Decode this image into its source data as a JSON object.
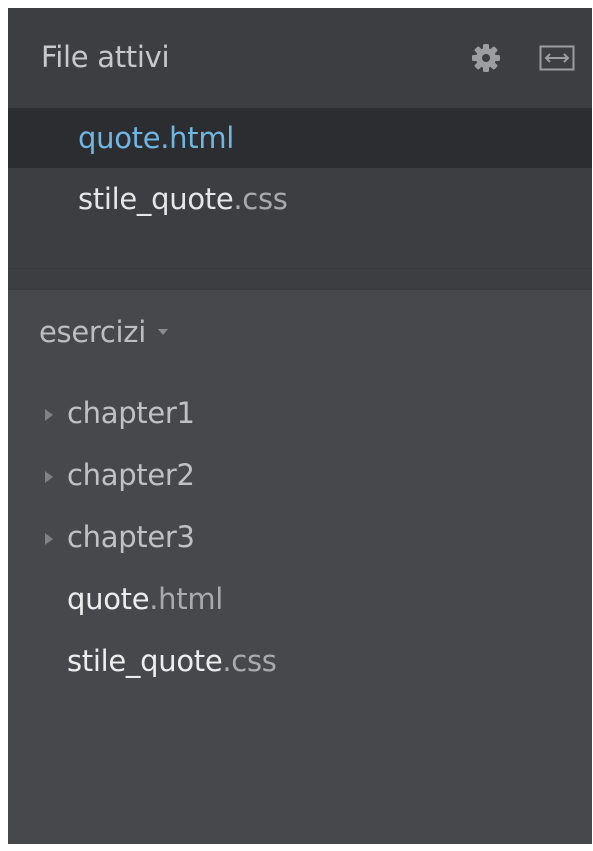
{
  "sidebar": {
    "working_set": {
      "title": "File attivi",
      "settings_icon": "gear-icon",
      "split_icon": "split-horizontal-icon",
      "files": [
        {
          "name": "quote",
          "ext": ".html",
          "selected": true
        },
        {
          "name": "stile_quote",
          "ext": ".css",
          "selected": false
        }
      ]
    },
    "project": {
      "title": "esercizi",
      "dropdown_icon": "caret-down-icon",
      "tree": [
        {
          "label": "chapter1",
          "type": "folder"
        },
        {
          "label": "chapter2",
          "type": "folder"
        },
        {
          "label": "chapter3",
          "type": "folder"
        },
        {
          "name": "quote",
          "ext": ".html",
          "type": "file"
        },
        {
          "name": "stile_quote",
          "ext": ".css",
          "type": "file"
        }
      ]
    }
  },
  "colors": {
    "panel_bg": "#47484c",
    "header_bg": "#3c3e42",
    "selected_bg": "#2c2d30",
    "selected_text": "#6fb7e1"
  }
}
